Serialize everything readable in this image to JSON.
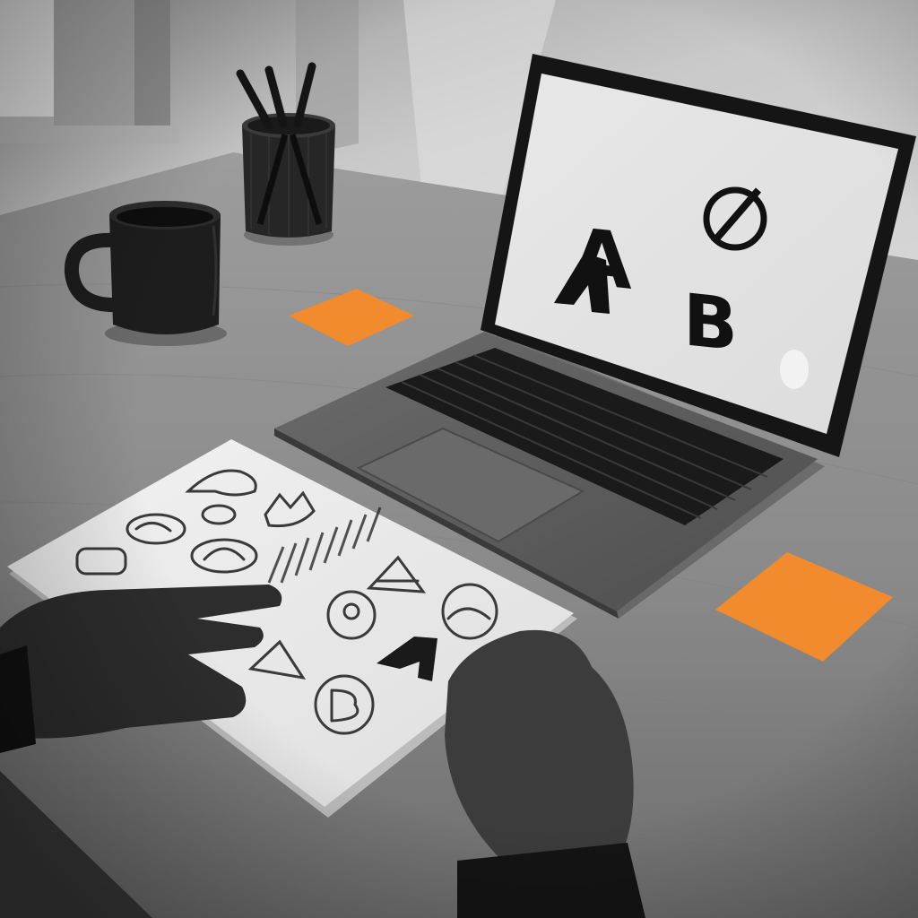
{
  "scene": {
    "description_tag": "designer-desk-scene",
    "colors": {
      "wall": "#cfcfcf",
      "desk": "#8d8d8d",
      "accent": "#f28a2e",
      "ink": "#111111",
      "paper": "#efefef",
      "laptop_body": "#5e5e5e",
      "screen": "#e4e4e4"
    },
    "laptop_screen_glyphs": [
      "A",
      "B"
    ],
    "icons": {
      "mug": "mug-icon",
      "pencil_cup": "pencil-cup-icon",
      "sticky_note": "sticky-note-icon",
      "pencil": "pencil-icon"
    }
  }
}
